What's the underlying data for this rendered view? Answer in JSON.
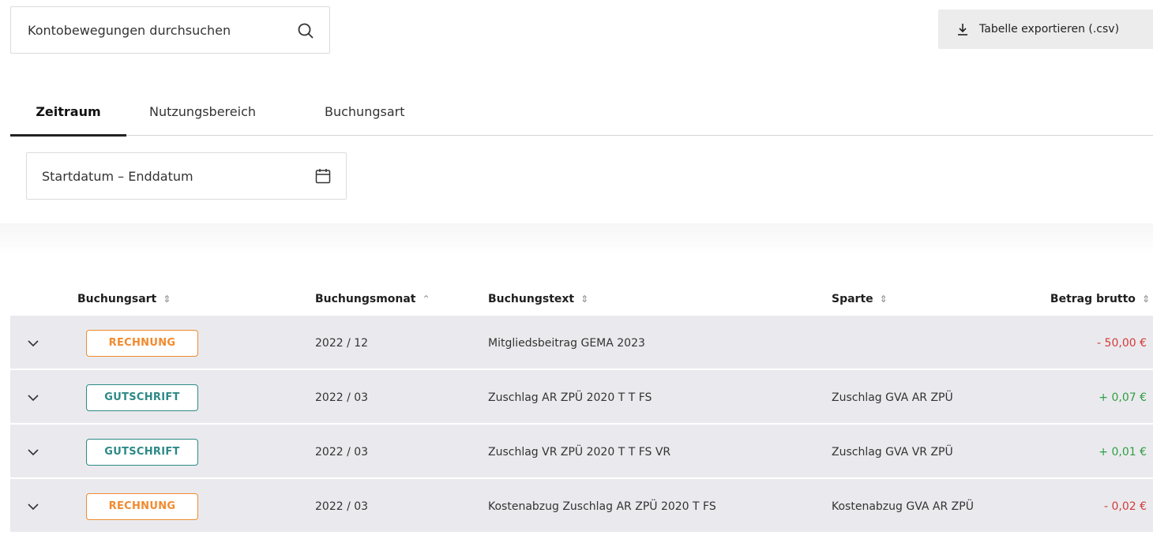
{
  "search": {
    "placeholder": "Kontobewegungen durchsuchen",
    "icon": "search-icon"
  },
  "export": {
    "label": "Tabelle exportieren (.csv)",
    "icon": "download-icon"
  },
  "tabs": [
    {
      "label": "Zeitraum",
      "active": true
    },
    {
      "label": "Nutzungsbereich",
      "active": false
    },
    {
      "label": "Buchungsart",
      "active": false
    }
  ],
  "daterange": {
    "placeholder": "Startdatum – Enddatum",
    "icon": "calendar-icon"
  },
  "table": {
    "headers": {
      "buchungsart": "Buchungsart",
      "buchungsmonat": "Buchungsmonat",
      "buchungstext": "Buchungstext",
      "sparte": "Sparte",
      "betrag": "Betrag brutto"
    },
    "sort": {
      "column": "buchungsmonat",
      "direction": "ascending"
    },
    "rows": [
      {
        "type": "RECHNUNG",
        "month": "2022 / 12",
        "text": "Mitgliedsbeitrag GEMA 2023",
        "sparte": "",
        "amount": "- 50,00 €"
      },
      {
        "type": "GUTSCHRIFT",
        "month": "2022 / 03",
        "text": "Zuschlag AR ZPÜ 2020 T T FS",
        "sparte": "Zuschlag GVA AR ZPÜ",
        "amount": "+ 0,07 €"
      },
      {
        "type": "GUTSCHRIFT",
        "month": "2022 / 03",
        "text": "Zuschlag VR ZPÜ 2020 T T FS VR",
        "sparte": "Zuschlag GVA VR ZPÜ",
        "amount": "+ 0,01 €"
      },
      {
        "type": "RECHNUNG",
        "month": "2022 / 03",
        "text": "Kostenabzug Zuschlag AR ZPÜ 2020 T FS",
        "sparte": "Kostenabzug GVA AR ZPÜ",
        "amount": "- 0,02 €"
      }
    ]
  },
  "colors": {
    "rechnung": "#f28a2e",
    "gutschrift": "#2c8a86",
    "negative": "#d33b3b",
    "positive": "#2f9e44",
    "row_background": "#eaeaee"
  }
}
